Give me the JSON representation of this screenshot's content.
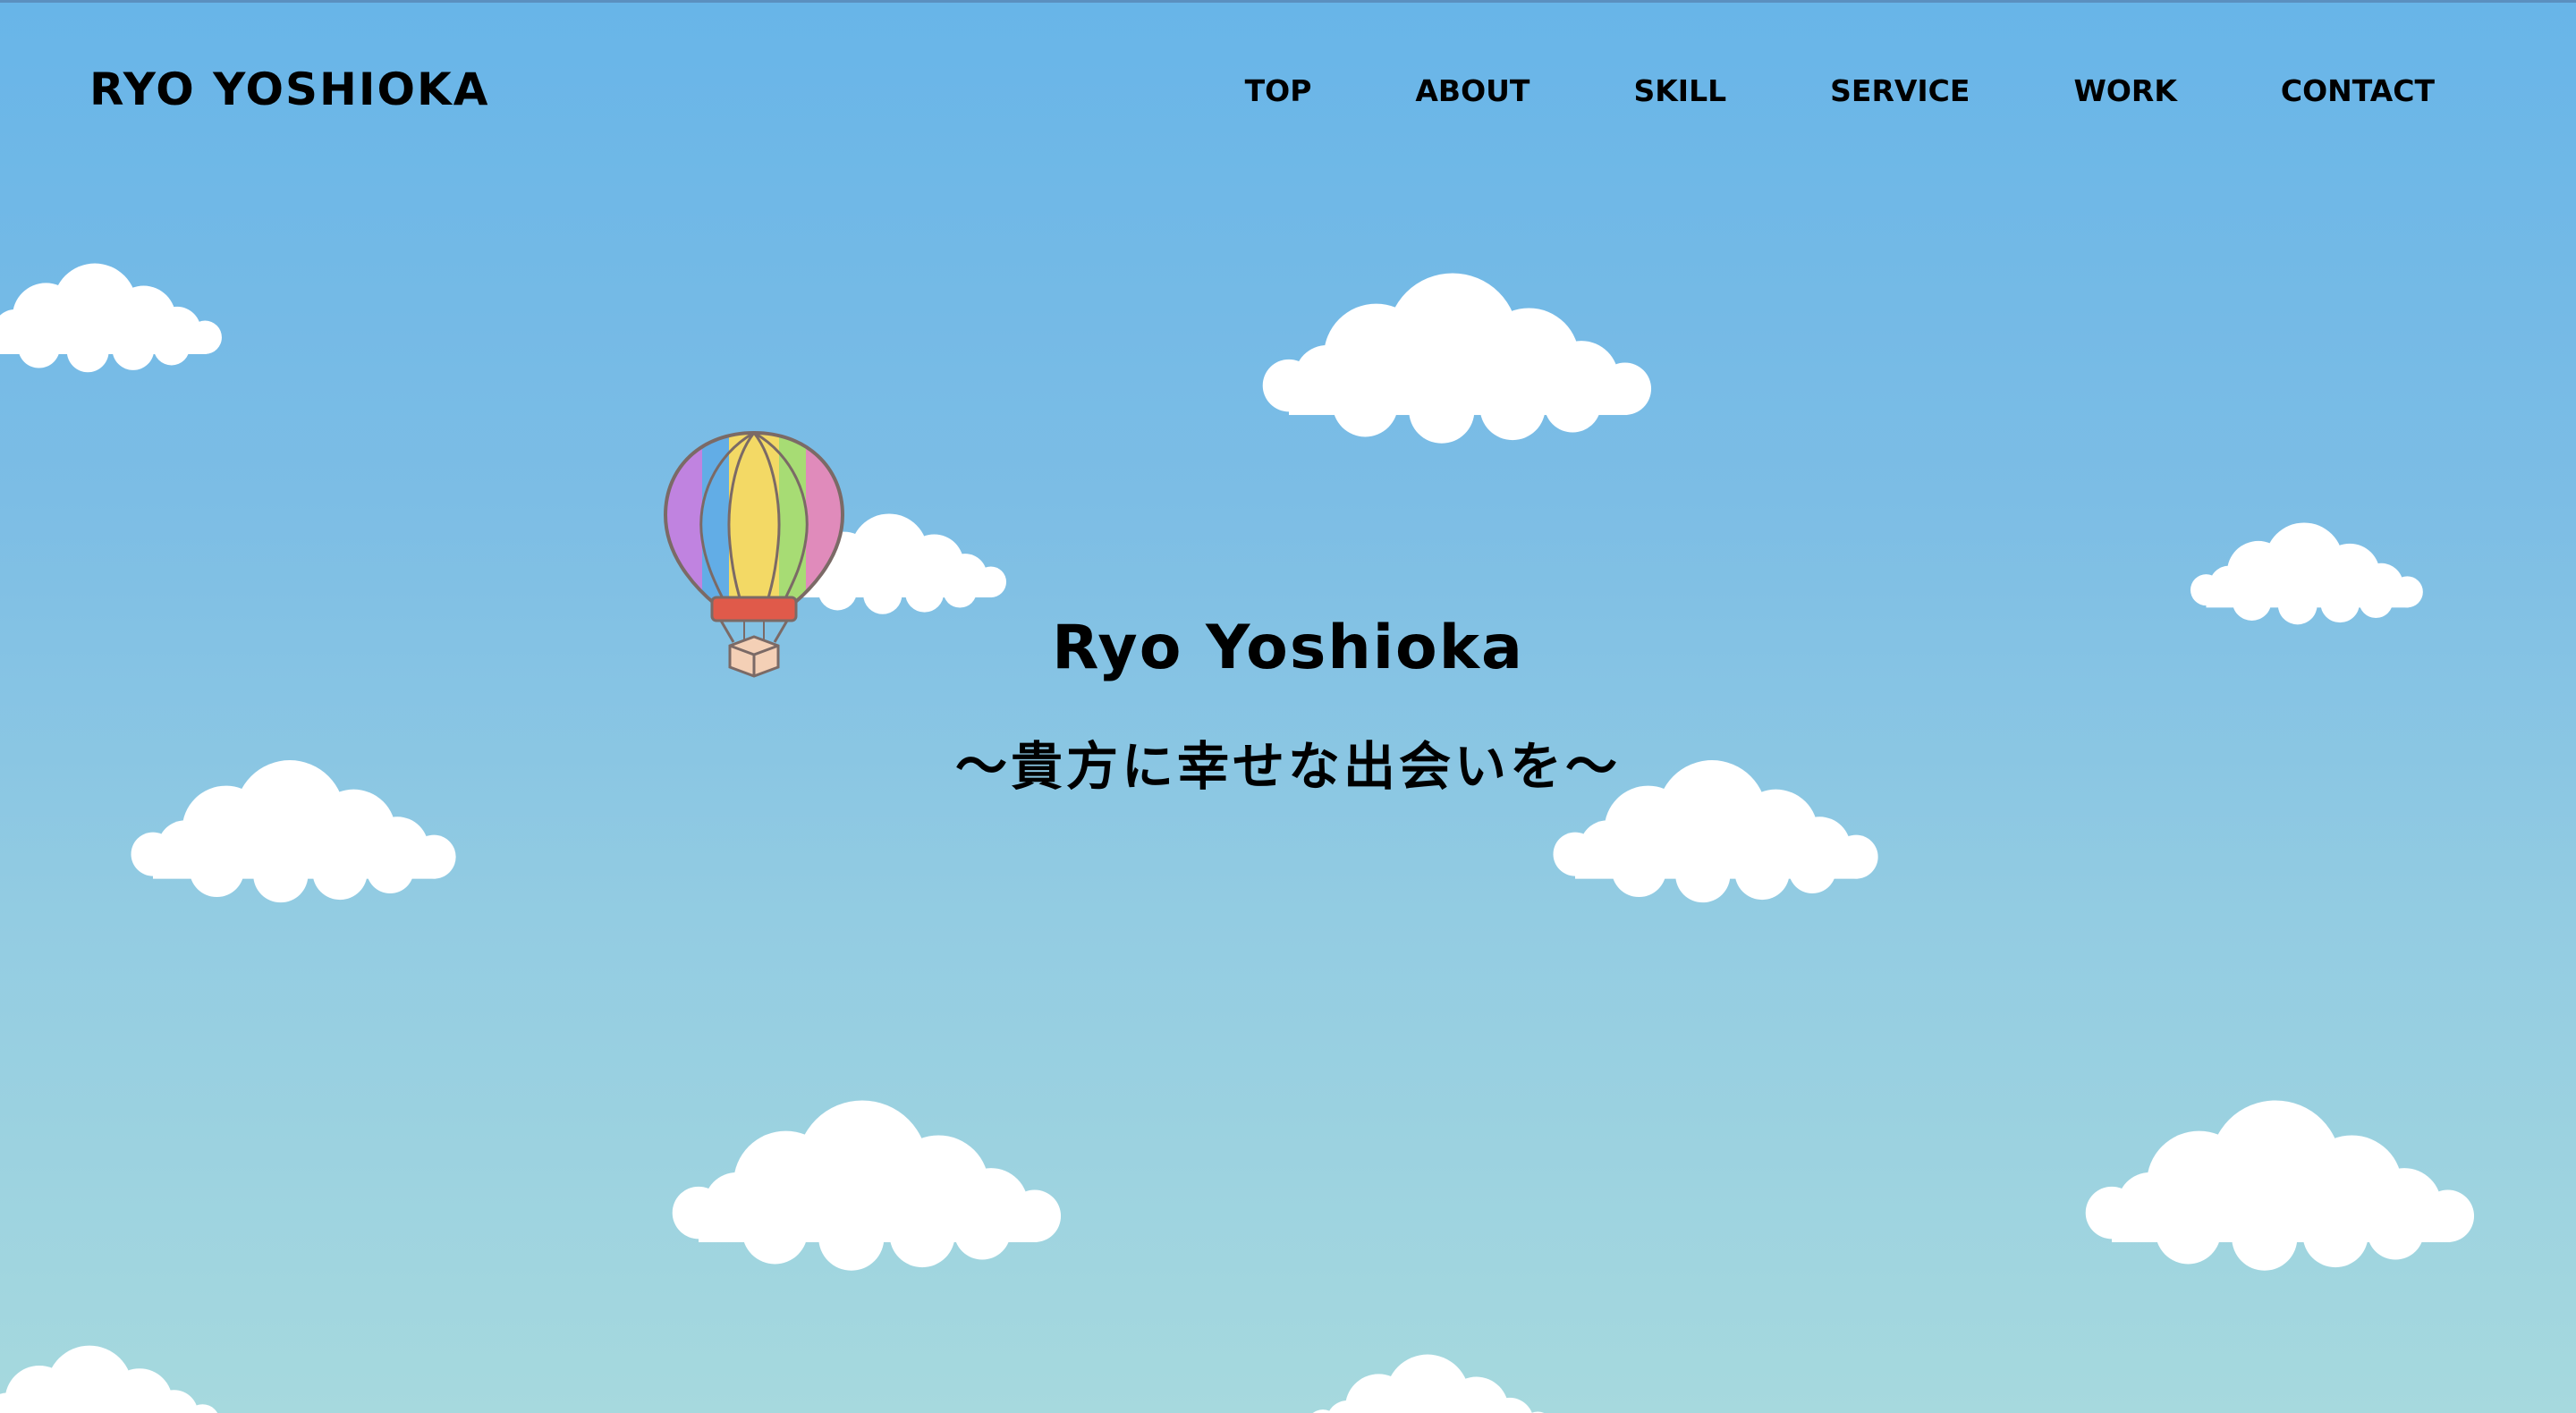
{
  "header": {
    "logo": "RYO YOSHIOKA",
    "nav": [
      "TOP",
      "ABOUT",
      "SKILL",
      "SERVICE",
      "WORK",
      "CONTACT"
    ]
  },
  "hero": {
    "name": "Ryo Yoshioka",
    "tagline": "〜貴方に幸せな出会いを〜"
  },
  "colors": {
    "sky_top": "#68b5e8",
    "sky_bottom": "#a6d9de",
    "cloud": "#ffffff",
    "text": "#000000"
  },
  "icons": [
    "hot-air-balloon-icon",
    "cloud-icon"
  ]
}
